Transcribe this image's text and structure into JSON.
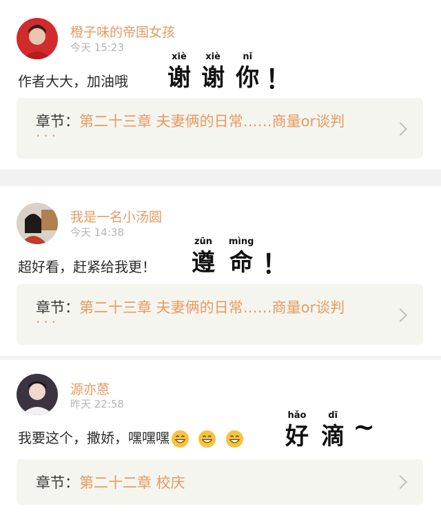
{
  "comments": [
    {
      "username": "橙子味的帝国女孩",
      "time": "今天 15:23",
      "text": "作者大大，加油哦",
      "reply": {
        "chars": [
          {
            "hanzi": "谢",
            "pinyin": "xiè"
          },
          {
            "hanzi": "谢",
            "pinyin": "xiè"
          },
          {
            "hanzi": "你",
            "pinyin": "nǐ"
          }
        ],
        "mark": "！"
      },
      "chapter": {
        "label": "章节：",
        "title": "第二十三章 夫妻俩的日常……商量or谈判",
        "ellipsis": "···"
      }
    },
    {
      "username": "我是一名小汤圆",
      "time": "今天 14:38",
      "text": "超好看，赶紧给我更！",
      "reply": {
        "chars": [
          {
            "hanzi": "遵",
            "pinyin": "zūn"
          },
          {
            "hanzi": "命",
            "pinyin": "mìng"
          }
        ],
        "mark": "！"
      },
      "chapter": {
        "label": "章节：",
        "title": "第二十三章 夫妻俩的日常……商量or谈判",
        "ellipsis": "···"
      }
    },
    {
      "username": "源亦蒽",
      "time": "昨天 22:58",
      "text": "我要这个，撒娇，嘿嘿嘿",
      "emojis": [
        "grinning-face-emoji",
        "grinning-face-emoji",
        "grinning-face-emoji"
      ],
      "reply": {
        "chars": [
          {
            "hanzi": "好",
            "pinyin": "hǎo"
          },
          {
            "hanzi": "滴",
            "pinyin": "dī"
          }
        ],
        "mark": "~"
      },
      "chapter": {
        "label": "章节：",
        "title": "第二十二章 校庆"
      }
    }
  ],
  "colors": {
    "username": "#e79a60",
    "chapter_title": "#e79a60",
    "time": "#b4b4b4",
    "chapter_bg": "#f5f5ef",
    "divider": "#f2f2f2"
  },
  "icons": [
    "avatar-photo",
    "grinning-face-emoji",
    "chevron-right-icon"
  ]
}
